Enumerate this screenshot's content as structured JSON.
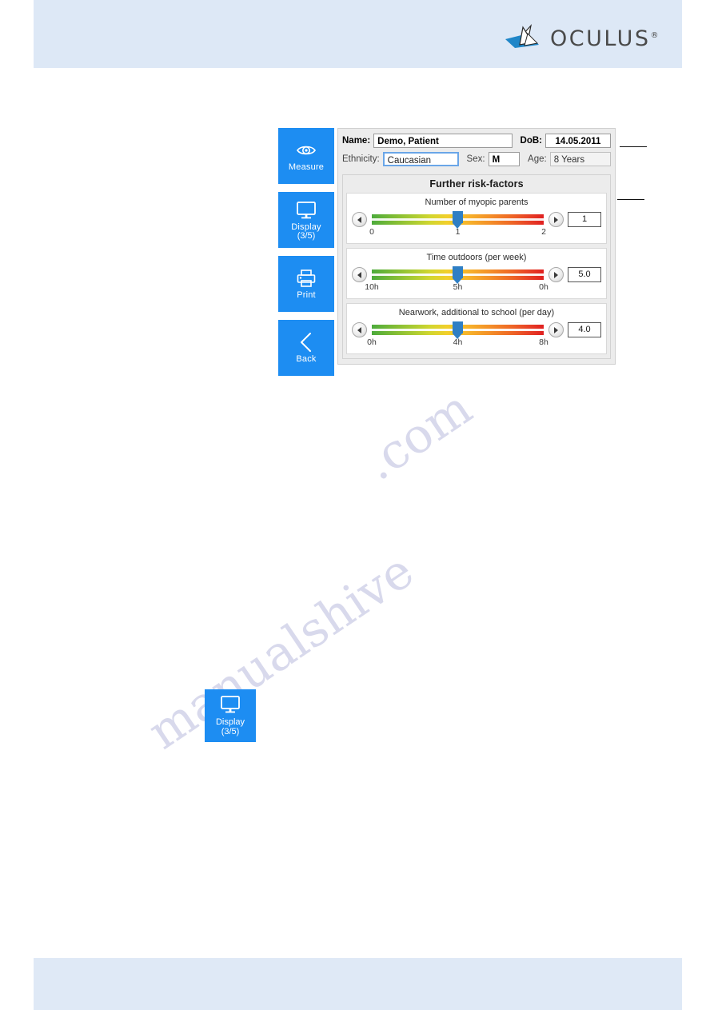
{
  "brand": {
    "name": "OCULUS",
    "registered": "®",
    "logo_icon": "oculus-arrow-logo",
    "accent_color": "#1d8df2",
    "header_band_color": "#dde8f6"
  },
  "sidebar": {
    "items": [
      {
        "label": "Measure",
        "label2": "",
        "icon": "eye-icon"
      },
      {
        "label": "Display",
        "label2": "(3/5)",
        "icon": "monitor-icon"
      },
      {
        "label": "Print",
        "label2": "",
        "icon": "printer-icon"
      },
      {
        "label": "Back",
        "label2": "",
        "icon": "chevron-left-icon"
      }
    ]
  },
  "patient": {
    "name_label": "Name:",
    "name_value": "Demo, Patient",
    "dob_label": "DoB:",
    "dob_value": "14.05.2011",
    "ethnicity_label": "Ethnicity:",
    "ethnicity_value": "Caucasian",
    "sex_label": "Sex:",
    "sex_value": "M",
    "age_label": "Age:",
    "age_value": "8 Years"
  },
  "risk_panel": {
    "title": "Further risk-factors",
    "sliders": [
      {
        "caption": "Number of myopic parents",
        "value": "1",
        "thumb_percent": 50,
        "ticks": [
          {
            "label": "0",
            "percent": 0
          },
          {
            "label": "1",
            "percent": 50
          },
          {
            "label": "2",
            "percent": 100
          }
        ]
      },
      {
        "caption": "Time outdoors (per week)",
        "value": "5.0",
        "thumb_percent": 50,
        "ticks": [
          {
            "label": "10h",
            "percent": 0
          },
          {
            "label": "5h",
            "percent": 50
          },
          {
            "label": "0h",
            "percent": 100
          }
        ]
      },
      {
        "caption": "Nearwork, additional to school (per day)",
        "value": "4.0",
        "thumb_percent": 50,
        "ticks": [
          {
            "label": "0h",
            "percent": 0
          },
          {
            "label": "4h",
            "percent": 50
          },
          {
            "label": "8h",
            "percent": 100
          }
        ]
      }
    ],
    "prev_icon": "chevron-left-icon",
    "next_icon": "chevron-right-icon"
  },
  "standalone_button": {
    "label": "Display",
    "label2": "(3/5)",
    "icon": "monitor-icon"
  },
  "watermark": {
    "line1": "manualshive",
    "line2": ".com"
  }
}
